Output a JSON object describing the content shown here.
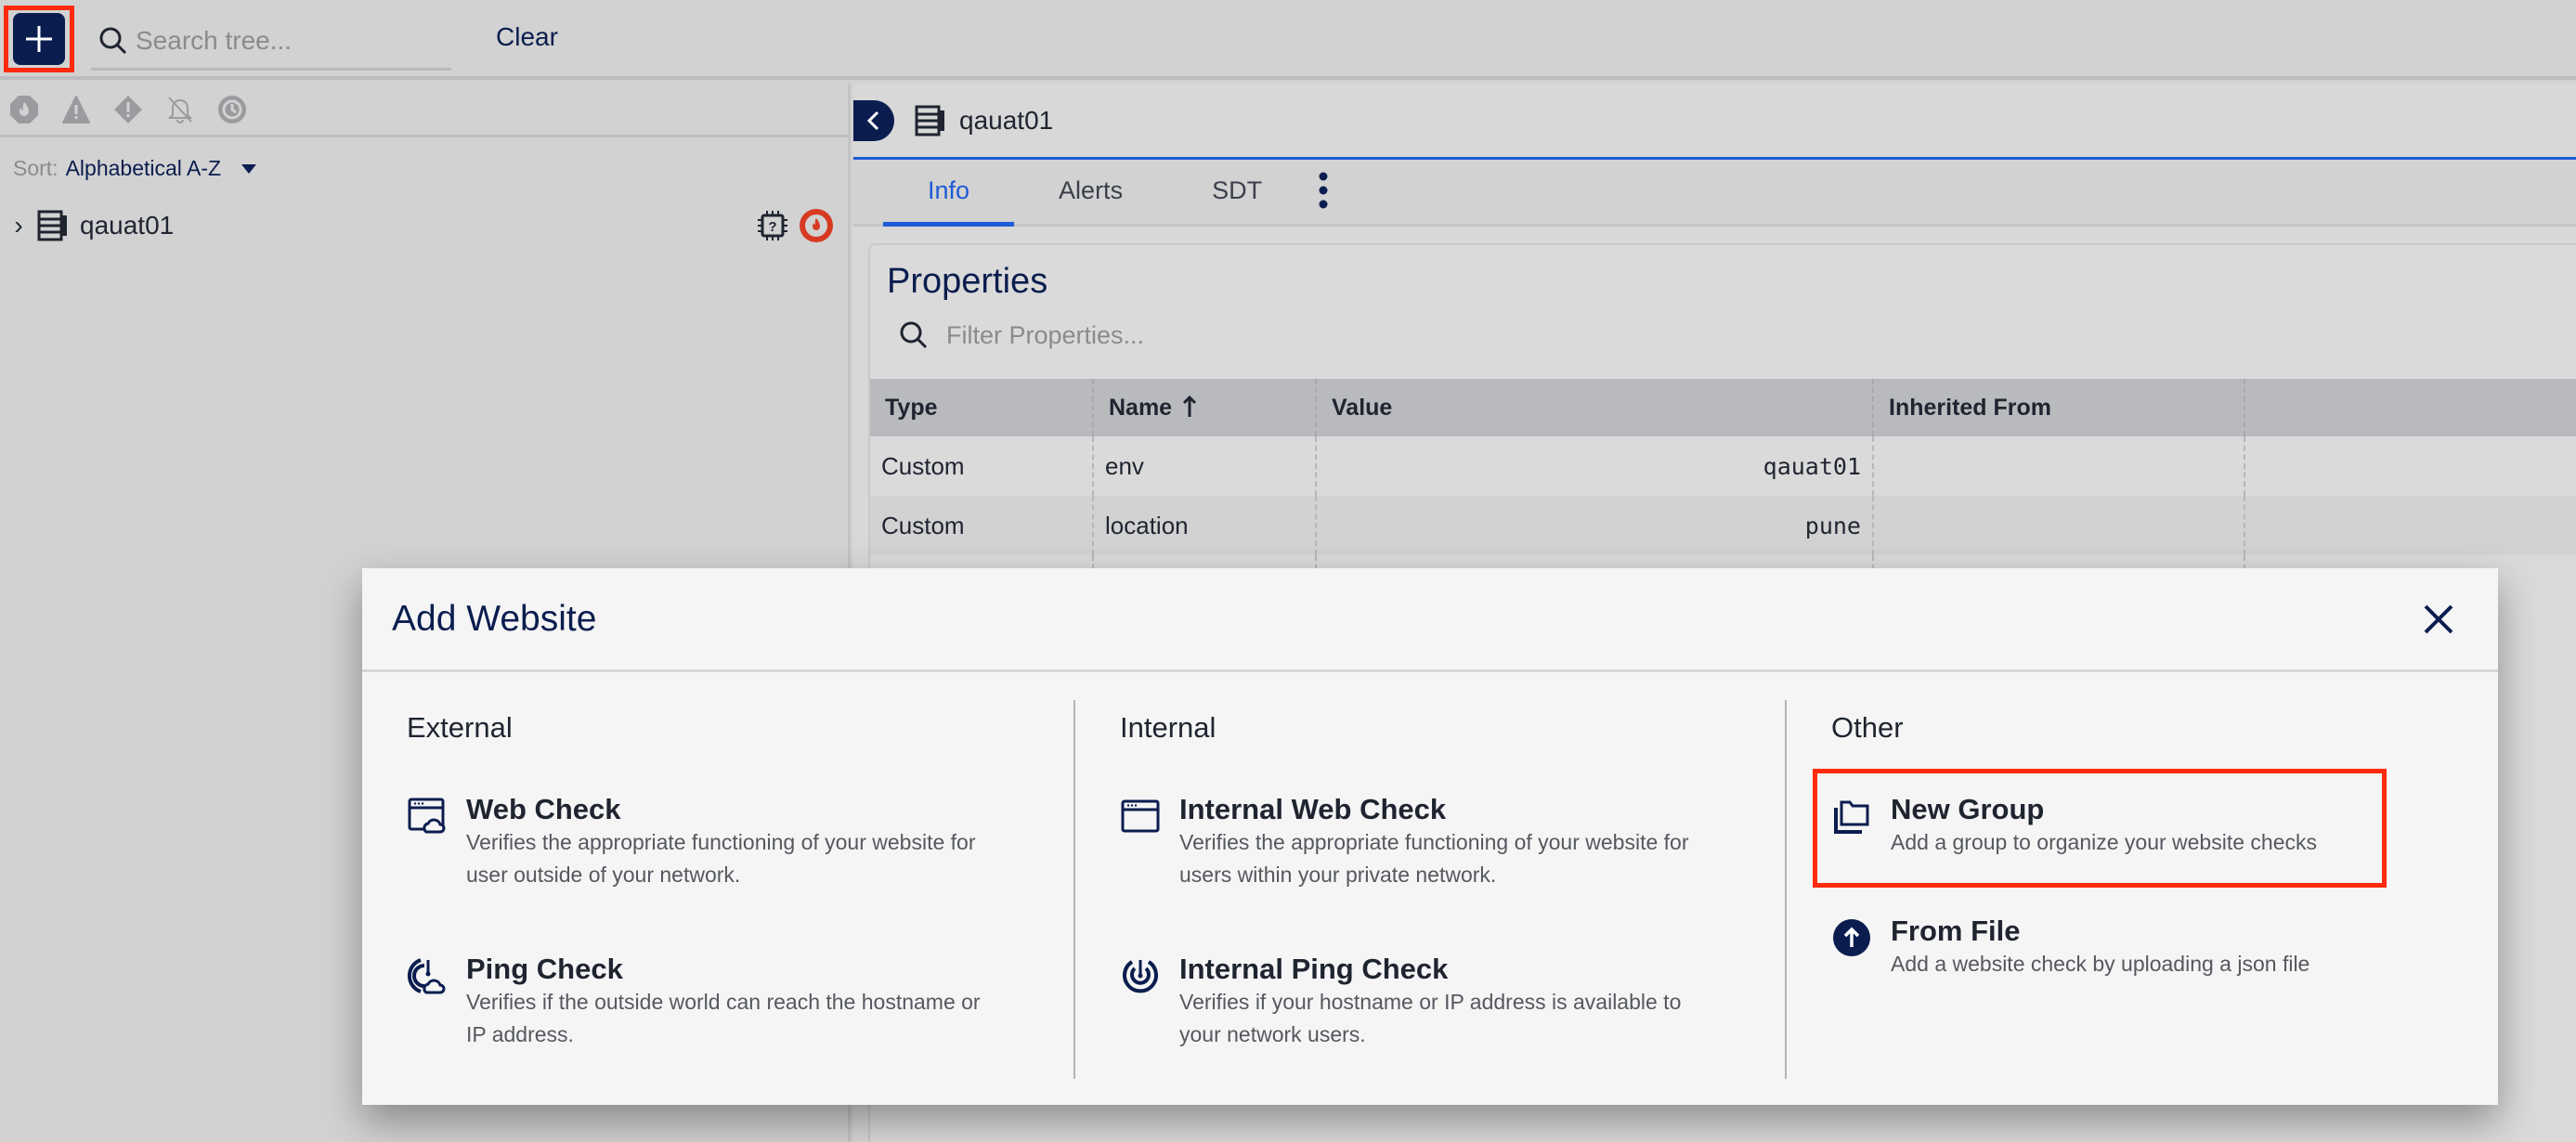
{
  "topbar": {
    "add_button_icon": "plus-icon",
    "search": {
      "placeholder": "Search tree...",
      "value": "",
      "icon": "search-icon"
    },
    "clear_label": "Clear"
  },
  "left_panel": {
    "filters": [
      {
        "name": "critical-alert-filter",
        "icon": "fire-octagon-icon"
      },
      {
        "name": "warning-alert-filter",
        "icon": "warning-triangle-icon"
      },
      {
        "name": "error-alert-filter",
        "icon": "exclamation-diamond-icon"
      },
      {
        "name": "muted-alert-filter",
        "icon": "bell-off-icon"
      },
      {
        "name": "sdt-filter",
        "icon": "clock-icon"
      }
    ],
    "sort": {
      "label": "Sort:",
      "value": "Alphabetical A-Z"
    },
    "tree": [
      {
        "label": "qauat01",
        "icon": "server-icon",
        "status_icons": [
          "chip-unknown-icon",
          "critical-alert-icon"
        ],
        "status_color": "#d63a22"
      }
    ]
  },
  "right_pane": {
    "resource_title": "qauat01",
    "tabs": [
      {
        "label": "Info",
        "active": true
      },
      {
        "label": "Alerts",
        "active": false
      },
      {
        "label": "SDT",
        "active": false
      }
    ],
    "properties": {
      "title": "Properties",
      "filter_placeholder": "Filter Properties...",
      "columns": [
        "Type",
        "Name",
        "Value",
        "Inherited From",
        ""
      ],
      "sort_column": "Name",
      "sort_direction": "ascending",
      "rows": [
        {
          "type": "Custom",
          "name": "env",
          "value": "qauat01",
          "inherited_from": ""
        },
        {
          "type": "Custom",
          "name": "location",
          "value": "pune",
          "inherited_from": ""
        }
      ]
    }
  },
  "modal": {
    "title": "Add Website",
    "columns": [
      {
        "heading": "External",
        "options": [
          {
            "title": "Web Check",
            "description": "Verifies the appropriate functioning of your website for user outside of your network.",
            "icon": "web-cloud-icon"
          },
          {
            "title": "Ping Check",
            "description": "Verifies if the outside world can reach the hostname or IP address.",
            "icon": "ping-cloud-icon"
          }
        ]
      },
      {
        "heading": "Internal",
        "options": [
          {
            "title": "Internal Web Check",
            "description": "Verifies the appropriate functioning of your website for users within your private network.",
            "icon": "browser-window-icon"
          },
          {
            "title": "Internal Ping Check",
            "description": "Verifies if your hostname or IP address is available to your network users.",
            "icon": "ping-icon"
          }
        ]
      },
      {
        "heading": "Other",
        "options": [
          {
            "title": "New Group",
            "description": "Add a group to organize your website checks",
            "icon": "folders-icon",
            "highlighted": true
          },
          {
            "title": "From File",
            "description": "Add a website check by uploading a json file",
            "icon": "upload-circle-icon"
          }
        ]
      }
    ]
  },
  "colors": {
    "brand_navy": "#0b1d4f",
    "accent_blue": "#1e5bd6",
    "highlight_red": "#ff2a0e",
    "critical_red": "#d63a22"
  }
}
